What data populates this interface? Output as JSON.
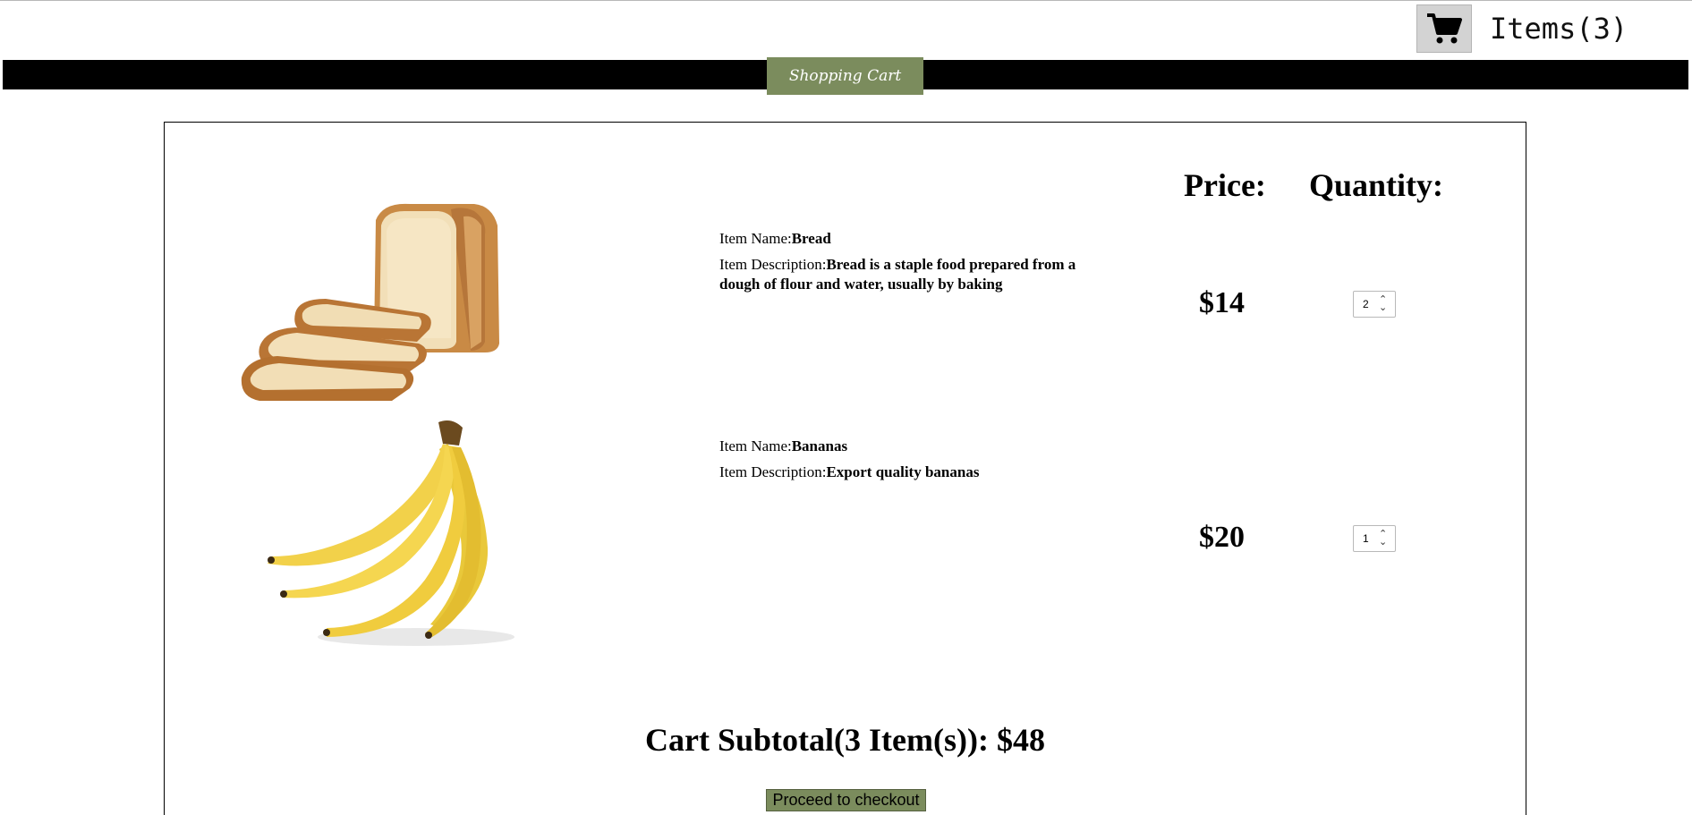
{
  "header": {
    "items_label": "Items(3)",
    "cart_icon": "shopping-cart-icon"
  },
  "nav": {
    "title": "Shopping Cart"
  },
  "cart": {
    "price_header": "Price:",
    "quantity_header": "Quantity:",
    "name_label": "Item Name:",
    "description_label": "Item Description:",
    "items": [
      {
        "name": "Bread",
        "description": "Bread is a staple food prepared from a dough of flour and water, usually by baking",
        "price": "$14",
        "quantity": "2",
        "image": "bread-image"
      },
      {
        "name": "Bananas",
        "description": "Export quality bananas",
        "price": "$20",
        "quantity": "1",
        "image": "bananas-image"
      }
    ],
    "subtotal": "Cart Subtotal(3 Item(s)): $48",
    "checkout_label": "Proceed to checkout"
  },
  "colors": {
    "accent": "#7b8c5d",
    "bar": "#000000"
  }
}
